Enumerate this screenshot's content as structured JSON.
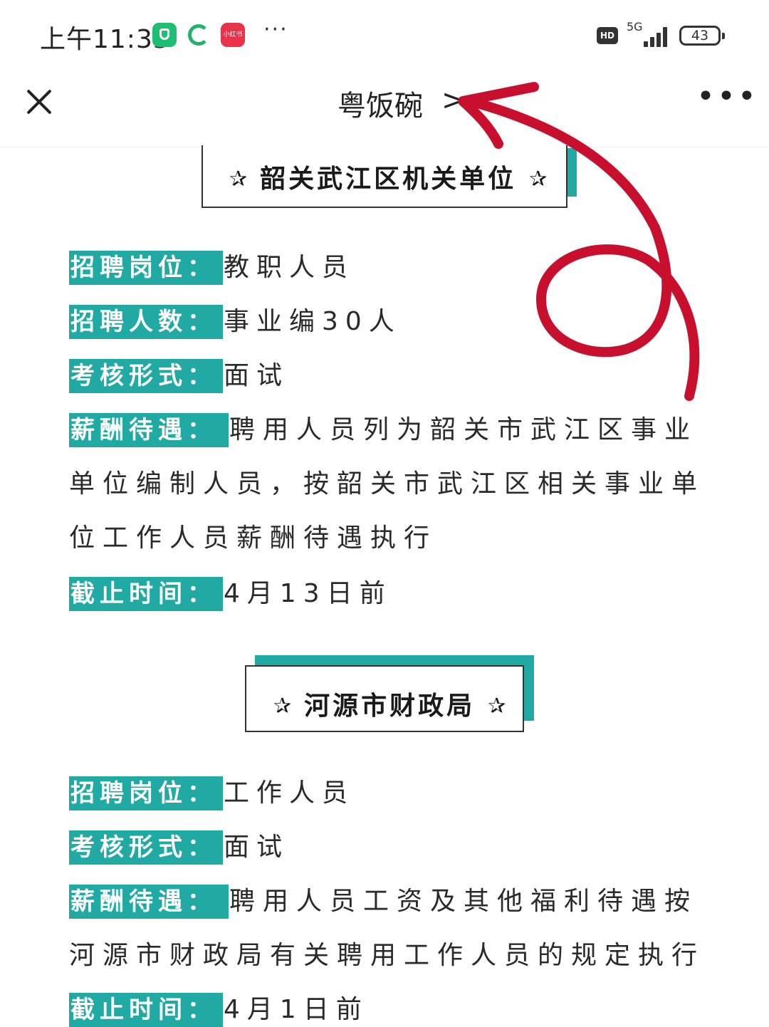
{
  "status_bar": {
    "time": "上午11:35",
    "app_icon_label": "小红书",
    "more": "···",
    "hd": "HD",
    "network": "5G",
    "battery": "43"
  },
  "nav": {
    "title": "粤饭碗",
    "chevron": ">",
    "more": "•••"
  },
  "sections": [
    {
      "header": "韶关武江区机关单位",
      "star": "✰",
      "fields": {
        "position_label": "招聘岗位：",
        "position_value": "教职人员",
        "count_label": "招聘人数：",
        "count_value": "事业编30人",
        "exam_label": "考核形式：",
        "exam_value": "面试",
        "salary_label": "薪酬待遇：",
        "salary_line1": "聘用人员列为韶关市武江区事业",
        "salary_line2": "单位编制人员，按韶关市武江区相关事业单",
        "salary_line3": "位工作人员薪酬待遇执行",
        "deadline_label": "截止时间：",
        "deadline_value": "4月13日前"
      }
    },
    {
      "header": "河源市财政局",
      "star": "✰",
      "fields": {
        "position_label": "招聘岗位：",
        "position_value": "工作人员",
        "exam_label": "考核形式：",
        "exam_value": "面试",
        "salary_label": "薪酬待遇：",
        "salary_line1": "聘用人员工资及其他福利待遇按",
        "salary_line2": "河源市财政局有关聘用工作人员的规定执行",
        "deadline_label": "截止时间：",
        "deadline_value": "4月1日前"
      }
    }
  ],
  "colors": {
    "accent": "#21aaa4",
    "arrow": "#c8102e",
    "text": "#2a2a2a"
  }
}
